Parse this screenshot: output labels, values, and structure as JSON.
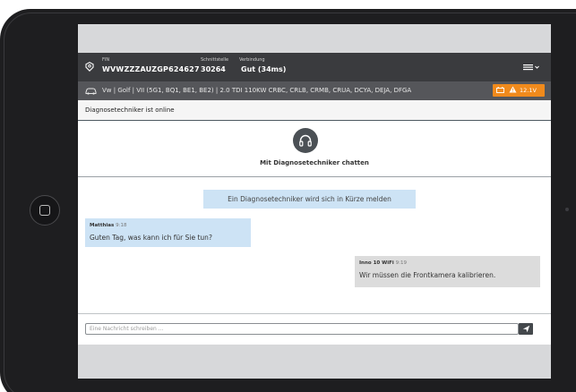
{
  "vehicle_info": {
    "fin_label": "FIN",
    "fin_value": "WVWZZZAUZGP624627",
    "interface_label": "Schnittstelle",
    "interface_value": "30264",
    "connection_label": "Verbindung",
    "connection_value": "Gut (34ms)",
    "menu_icon": "hamburger-menu-icon"
  },
  "vehicle_bar": {
    "icon": "car-icon",
    "description": "Vw | Golf | VII (5G1, BQ1, BE1, BE2) | 2.0 TDI 110KW CRBC, CRLB, CRMB, CRUA, DCYA, DEJA, DFGA",
    "battery_icon": "battery-icon",
    "warning_icon": "warning-icon",
    "voltage": "12.1V",
    "badge_color": "#f08a1c"
  },
  "status": {
    "text": "Diagnosetechniker ist online"
  },
  "chat": {
    "header_icon": "headset-icon",
    "title": "Mit Diagnosetechniker chatten",
    "system_message": "Ein Diagnosetechniker wird sich in Kürze melden",
    "messages": [
      {
        "sender": "Matthias",
        "time": "9:18",
        "text": "Guten Tag, was kann ich für Sie tun?"
      },
      {
        "sender": "Inno 10 WiFi",
        "time": "9:19",
        "text": "Wir müssen die Frontkamera kalibrieren."
      }
    ],
    "input_placeholder": "Eine Nachricht schreiben ...",
    "send_icon": "send-icon",
    "incoming_color": "#cde3f5",
    "outgoing_color": "#dcdcdc"
  }
}
